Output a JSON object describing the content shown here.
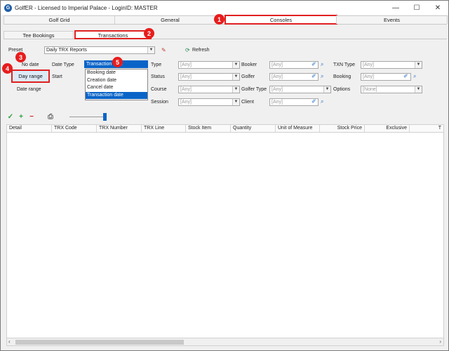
{
  "window": {
    "title": "GolfER - Licensed to Imperial Palace - LoginID: MASTER",
    "minimize": "—",
    "maximize": "☐",
    "close": "✕"
  },
  "top_tabs": [
    "Golf Grid",
    "General",
    "Consoles",
    "Events"
  ],
  "sub_tabs": [
    "Tee Bookings",
    "Transactions"
  ],
  "badges": [
    "1",
    "2",
    "3",
    "4",
    "5"
  ],
  "filters": {
    "preset_label": "Preset",
    "preset_value": "Daily TRX Reports",
    "refresh_label": "Refresh",
    "no_date": "No date",
    "day_range": "Day range",
    "date_range": "Date range",
    "date_type_label": "Date Type",
    "start_label": "Start",
    "date_type_value": "Transaction date",
    "date_type_options": [
      "Booking date",
      "Creation date",
      "Cancel date",
      "Transaction date"
    ],
    "type_label": "Type",
    "status_label": "Status",
    "course_label": "Course",
    "session_label": "Session",
    "booker_label": "Booker",
    "golfer_label": "Golfer",
    "golfer_type_label": "Golfer Type",
    "client_label": "Client",
    "txn_type_label": "TXN Type",
    "booking_label": "Booking",
    "options_label": "Options",
    "any": "[Any]",
    "none": "[None]"
  },
  "grid": {
    "columns": [
      "Detail",
      "TRX Code",
      "TRX Number",
      "TRX Line",
      "Stock Item",
      "Quantity",
      "Unit of Measure",
      "Stock Price",
      "Exclusive",
      "T"
    ]
  }
}
